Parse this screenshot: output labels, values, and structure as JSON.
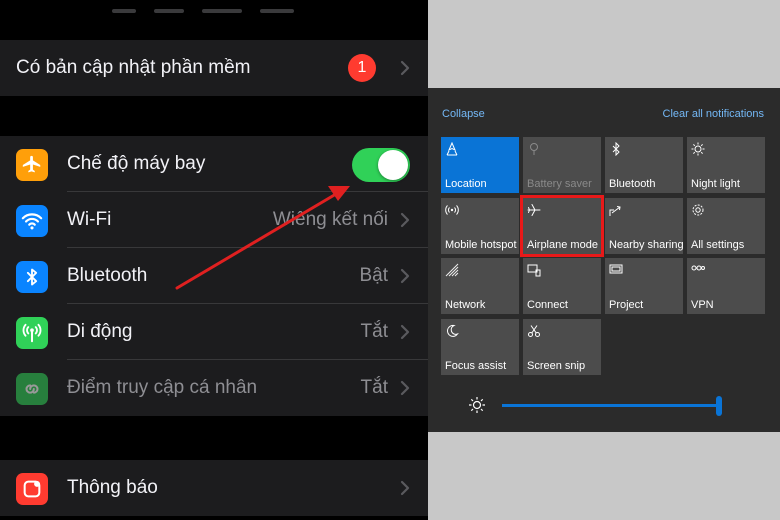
{
  "ios_settings": {
    "software_update": {
      "label": "Có bản cập nhật phần mềm",
      "badge": "1"
    },
    "connectivity": [
      {
        "key": "airplane",
        "label": "Chế độ máy bay",
        "icon": "airplane-icon",
        "color": "#ff9f0a",
        "control": "toggle",
        "on": true
      },
      {
        "key": "wifi",
        "label": "Wi-Fi",
        "value": "Wiêng kết nối",
        "icon": "wifi-icon",
        "color": "#0a84ff"
      },
      {
        "key": "bluetooth",
        "label": "Bluetooth",
        "value": "Bật",
        "icon": "bluetooth-icon",
        "color": "#0a84ff"
      },
      {
        "key": "cellular",
        "label": "Di động",
        "value": "Tắt",
        "icon": "cellular-antenna-icon",
        "color": "#30d158"
      },
      {
        "key": "hotspot",
        "label": "Điểm truy cập cá nhân",
        "value": "Tắt",
        "icon": "personal-hotspot-icon",
        "color": "#30d158",
        "disabled": true
      }
    ],
    "notifications": {
      "label": "Thông báo",
      "icon": "notifications-icon",
      "color": "#ff3b30"
    }
  },
  "action_center": {
    "collapse_label": "Collapse",
    "clear_label": "Clear all notifications",
    "tiles": [
      {
        "label": "Location",
        "icon": "location-icon",
        "active": true
      },
      {
        "label": "Battery saver",
        "icon": "battery-saver-icon",
        "disabled": true
      },
      {
        "label": "Bluetooth",
        "icon": "bluetooth-icon"
      },
      {
        "label": "Night light",
        "icon": "night-light-icon"
      },
      {
        "label": "Mobile hotspot",
        "icon": "mobile-hotspot-icon"
      },
      {
        "label": "Airplane mode",
        "icon": "airplane-icon",
        "highlighted": true
      },
      {
        "label": "Nearby sharing",
        "icon": "nearby-sharing-icon"
      },
      {
        "label": "All settings",
        "icon": "settings-gear-icon"
      },
      {
        "label": "Network",
        "icon": "network-icon"
      },
      {
        "label": "Connect",
        "icon": "connect-icon"
      },
      {
        "label": "Project",
        "icon": "project-icon"
      },
      {
        "label": "VPN",
        "icon": "vpn-icon"
      },
      {
        "label": "Focus assist",
        "icon": "focus-assist-icon"
      },
      {
        "label": "Screen snip",
        "icon": "screen-snip-icon"
      }
    ],
    "brightness": {
      "level": 1.0,
      "icon": "brightness-icon"
    }
  },
  "colors": {
    "ios_bg": "#000000",
    "ios_group": "#1c1c1e",
    "win_panel": "#2b2b2b",
    "win_accent": "#0a74d6",
    "highlight_red": "#e81919",
    "arrow_red": "#e02020"
  }
}
